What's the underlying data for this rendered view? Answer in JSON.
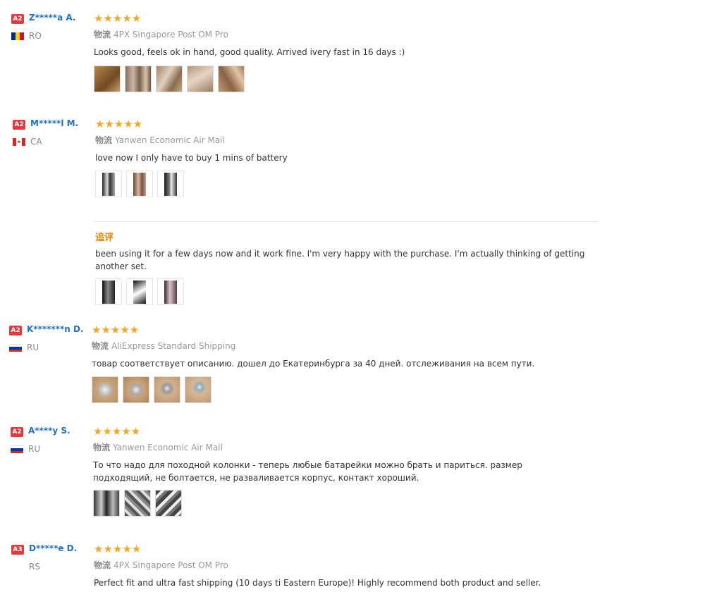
{
  "reviews": [
    {
      "level": "A2",
      "name": "Z*****a A.",
      "country": "RO",
      "flag": [
        "#002b7f",
        "#fcd116",
        "#ce1126"
      ],
      "stars": "★★★★★",
      "ship_label": "物流",
      "shipping": "4PX Singapore Post OM Pro",
      "text": "Looks good, feels ok in hand, good quality. Arrived ivery fast in 16 days :)"
    },
    {
      "level": "A2",
      "name": "M*****l M.",
      "country": "CA",
      "flag": [
        "#d52b1e",
        "#ffffff",
        "#d52b1e"
      ],
      "stars": "★★★★★",
      "ship_label": "物流",
      "shipping": "Yanwen Economic Air Mail",
      "text": "love now I only have to buy 1 mins of battery",
      "append_title": "追评",
      "append_text": "been using it for a few days now and it work fine. I'm very happy with the purchase. I'm actually thinking of getting another set."
    },
    {
      "level": "A2",
      "name": "K*******n D.",
      "country": "RU",
      "flag": [
        "#ffffff",
        "#0039a6",
        "#d52b1e"
      ],
      "stars": "★★★★★",
      "ship_label": "物流",
      "shipping": "AliExpress Standard Shipping",
      "text": "товар соответствует описанию. дошел до Екатеринбурга за 40 дней. отслеживания на всем пути."
    },
    {
      "level": "A2",
      "name": "A****y S.",
      "country": "RU",
      "flag": [
        "#ffffff",
        "#0039a6",
        "#d52b1e"
      ],
      "stars": "★★★★★",
      "ship_label": "物流",
      "shipping": "Yanwen Economic Air Mail",
      "text": "То что надо для походной колонки - теперь любые батарейки можно брать и париться. размер подходящий, не болтается, не разваливается корпус, контакт хороший."
    },
    {
      "level": "A3",
      "name": "D*****e D.",
      "country": "RS",
      "stars": "★★★★★",
      "ship_label": "物流",
      "shipping": "4PX Singapore Post OM Pro",
      "text": "Perfect fit and ultra fast shipping (10 days ti Eastern Europe)! Highly recommend both product and seller."
    }
  ]
}
